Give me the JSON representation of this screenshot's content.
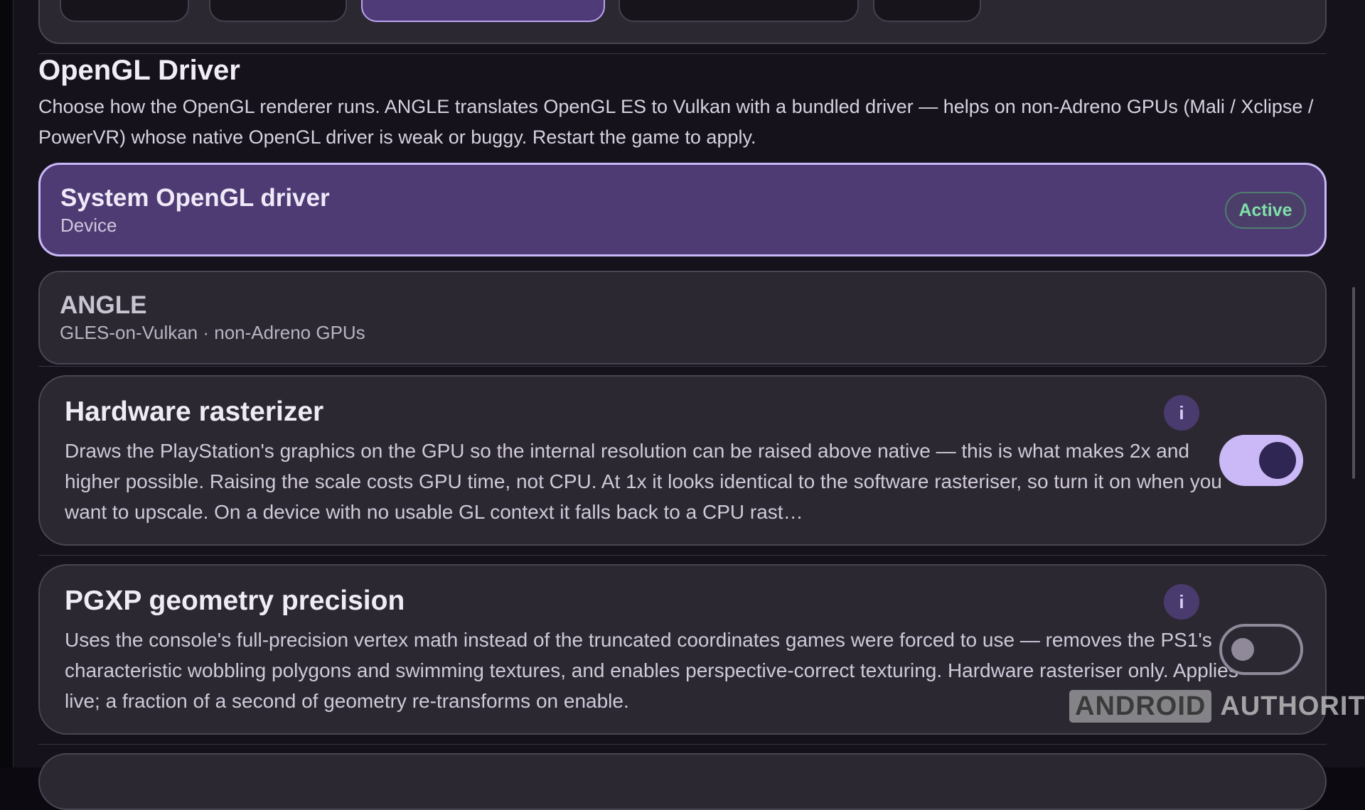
{
  "opengl": {
    "title": "OpenGL Driver",
    "description": "Choose how the OpenGL renderer runs. ANGLE translates OpenGL ES to Vulkan with a bundled driver — helps on non-Adreno GPUs (Mali / Xclipse / PowerVR) whose native OpenGL driver is weak or buggy. Restart the game to apply.",
    "options": [
      {
        "title": "System OpenGL driver",
        "subtitle": "Device",
        "badge": "Active",
        "selected": true
      },
      {
        "title": "ANGLE",
        "subtitle": "GLES-on-Vulkan · non-Adreno GPUs",
        "selected": false
      }
    ]
  },
  "settings": [
    {
      "title": "Hardware rasterizer",
      "description": "Draws the PlayStation's graphics on the GPU so the internal resolution can be raised above native — this is what makes 2x and higher possible. Raising the scale costs GPU time, not CPU. At 1x it looks identical to the software rasteriser, so turn it on when you want to upscale. On a device with no usable GL context it falls back to a CPU rast…",
      "info_label": "i",
      "enabled": true
    },
    {
      "title": "PGXP geometry precision",
      "description": "Uses the console's full-precision vertex math instead of the truncated coordinates games were forced to use — removes the PS1's characteristic wobbling polygons and swimming textures, and enables perspective-correct texturing. Hardware rasteriser only. Applies live; a fraction of a second of geometry re-transforms on enable.",
      "info_label": "i",
      "enabled": false
    }
  ],
  "watermark": {
    "brand": "ANDROID",
    "suffix": "AUTHORITY"
  },
  "colors": {
    "accent": "#cbb9f7",
    "selected_bg": "#4e3b74",
    "active_badge": "#7fe0a8",
    "card_bg": "#2c2832",
    "page_bg": "#15121b"
  }
}
